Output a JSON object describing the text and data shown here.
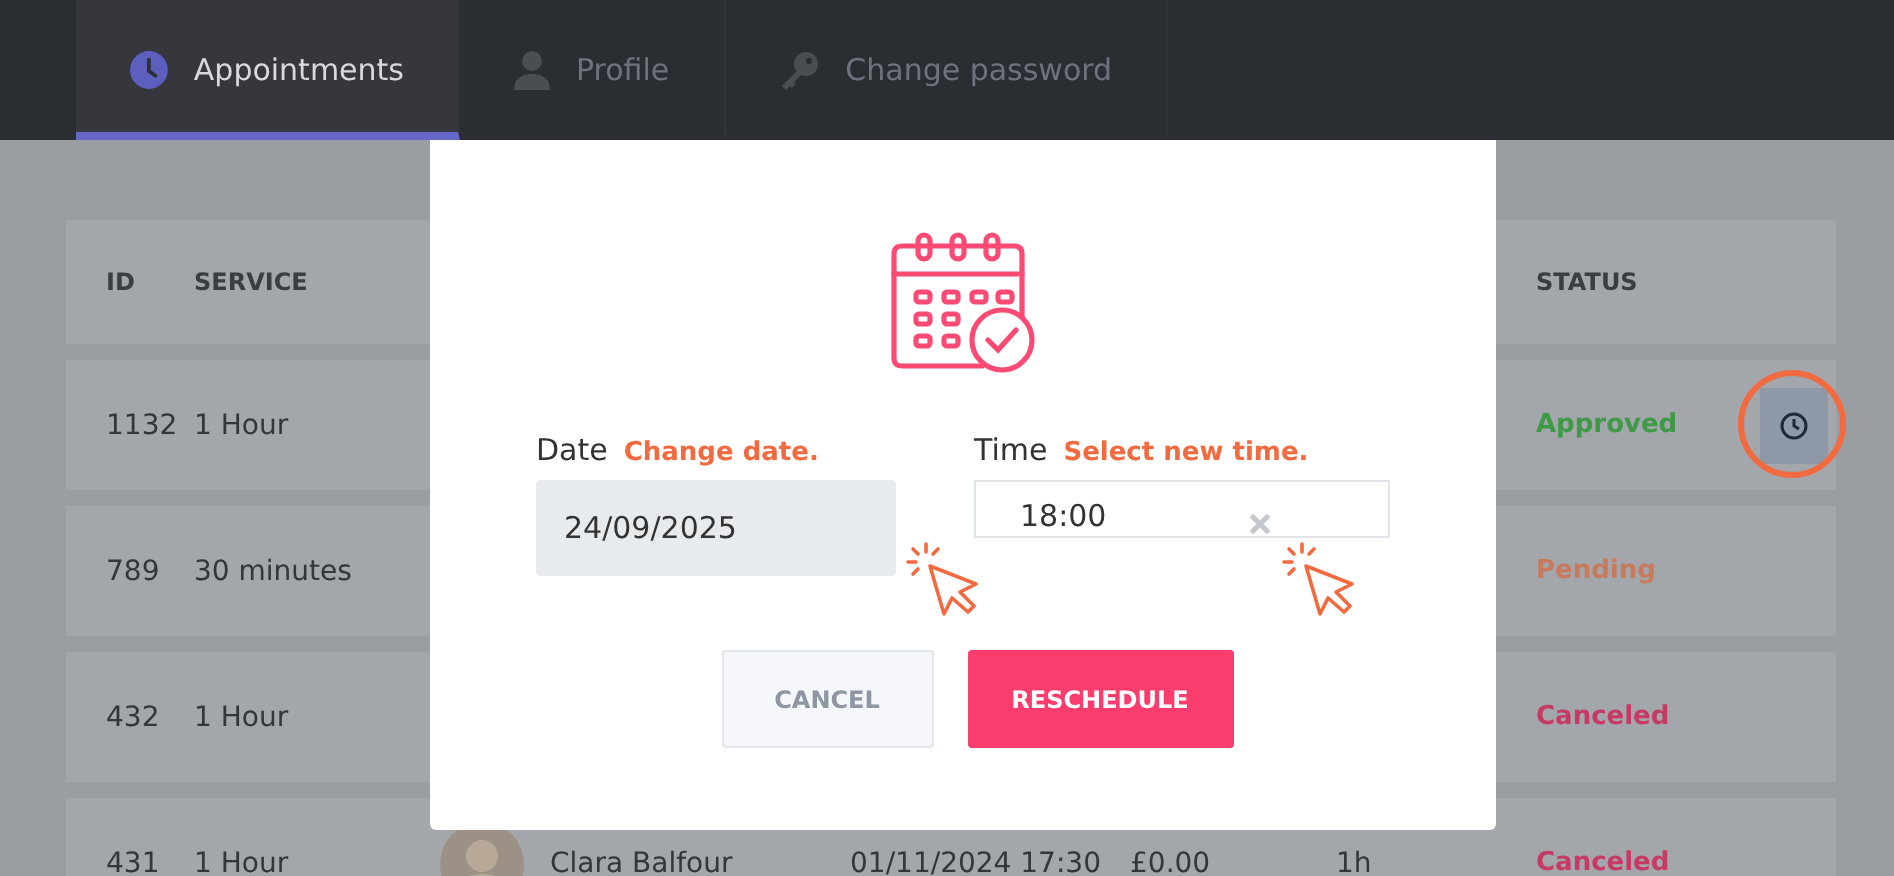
{
  "tabs": [
    {
      "label": "Appointments",
      "selected": true
    },
    {
      "label": "Profile",
      "selected": false
    },
    {
      "label": "Change password",
      "selected": false
    }
  ],
  "table": {
    "columns": [
      "ID",
      "SERVICE",
      "STATUS"
    ],
    "rows": [
      {
        "id": "1132",
        "service": "1 Hour",
        "status": "Approved",
        "color": "#3f9a47",
        "reschedule_button": true
      },
      {
        "id": "789",
        "service": "30 minutes",
        "status": "Pending",
        "color": "#c77a5c",
        "reschedule_button": false
      },
      {
        "id": "432",
        "service": "1 Hour",
        "status": "Canceled",
        "color": "#c63a63",
        "reschedule_button": false
      },
      {
        "id": "431",
        "service": "1 Hour",
        "customer": "Clara Balfour",
        "date": "01/11/2024 17:30",
        "price": "£0.00",
        "duration": "1h",
        "status": "Canceled",
        "color": "#c63a63",
        "reschedule_button": false
      }
    ]
  },
  "modal": {
    "date": {
      "label": "Date",
      "hint": "Change date.",
      "value": "24/09/2025"
    },
    "time": {
      "label": "Time",
      "hint": "Select new time.",
      "value": "18:00",
      "clearable": true
    },
    "buttons": [
      {
        "label": "CANCEL",
        "kind": "secondary"
      },
      {
        "label": "RESCHEDULE",
        "kind": "primary"
      }
    ]
  },
  "annotations": {
    "date_cursor": true,
    "time_cursor": true,
    "button_circle": true
  }
}
